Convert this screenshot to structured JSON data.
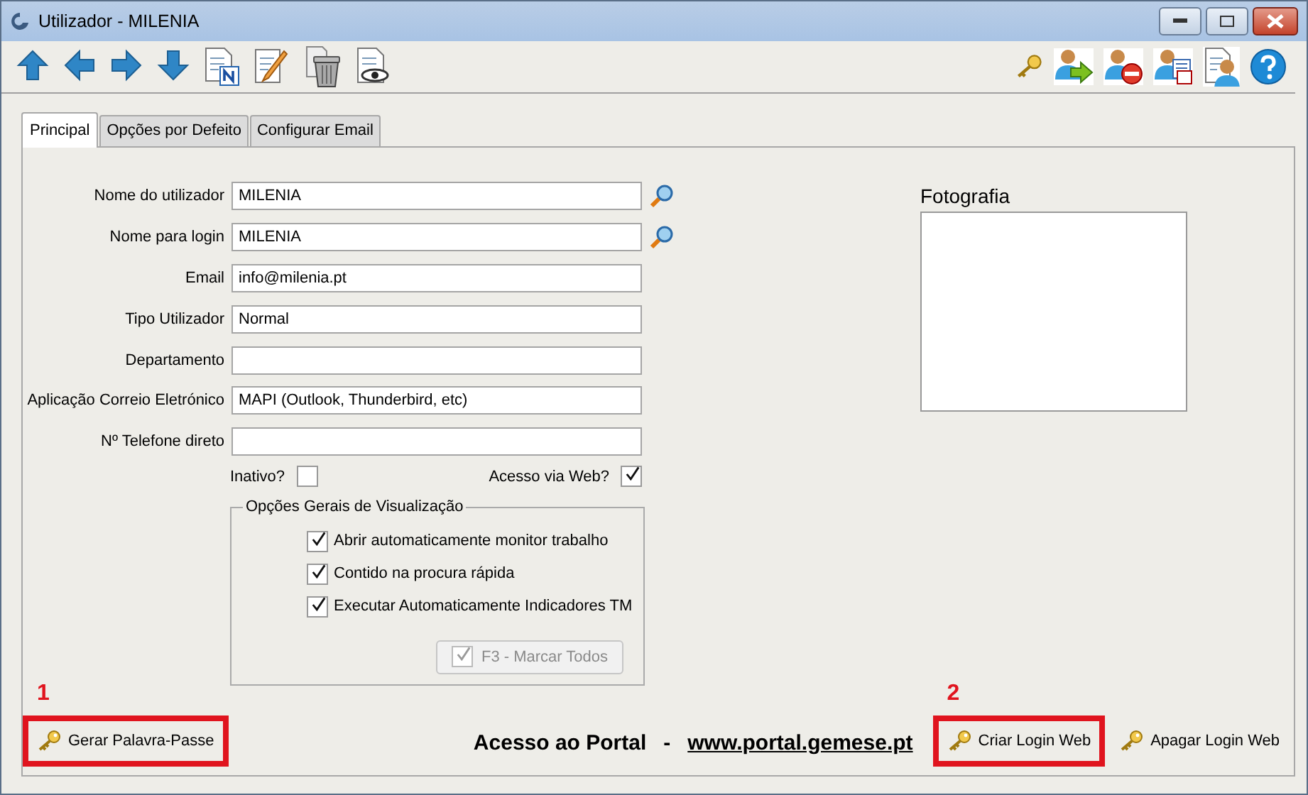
{
  "window": {
    "title": "Utilizador - MILENIA"
  },
  "toolbar": {
    "left": [
      {
        "kind": "up"
      },
      {
        "kind": "left"
      },
      {
        "kind": "right"
      },
      {
        "kind": "down"
      },
      {
        "kind": "new"
      },
      {
        "kind": "edit"
      },
      {
        "kind": "delete"
      },
      {
        "kind": "view"
      }
    ],
    "right": [
      {
        "kind": "key"
      },
      {
        "kind": "user-arrow"
      },
      {
        "kind": "user-remove"
      },
      {
        "kind": "user-calendar"
      },
      {
        "kind": "user-doc"
      },
      {
        "kind": "help"
      }
    ]
  },
  "tabs": [
    {
      "label": "Principal",
      "selected": true
    },
    {
      "label": "Opções por Defeito",
      "selected": false
    },
    {
      "label": "Configurar Email",
      "selected": false
    }
  ],
  "fields": [
    {
      "label": "Nome do utilizador",
      "value": "MILENIA",
      "search": true
    },
    {
      "label": "Nome para login",
      "value": "MILENIA",
      "search": true
    },
    {
      "label": "Email",
      "value": "info@milenia.pt",
      "search": false
    },
    {
      "label": "Tipo Utilizador",
      "value": "Normal",
      "search": false
    },
    {
      "label": "Departamento",
      "search": false
    },
    {
      "label": "Aplicação Correio Eletrónico",
      "value": "MAPI (Outlook, Thunderbird, etc)",
      "search": false
    },
    {
      "label": "Nº Telefone direto",
      "search": false
    }
  ],
  "flags": [
    {
      "label": "Inativo?",
      "checked": false
    },
    {
      "label": "Acesso via Web?",
      "checked": true
    }
  ],
  "view_options": {
    "title": "Opções Gerais de Visualização",
    "items": [
      {
        "label": "Abrir automaticamente monitor trabalho",
        "checked": true
      },
      {
        "label": "Contido na procura rápida",
        "checked": true
      },
      {
        "label": "Executar Automaticamente Indicadores TM",
        "checked": true
      }
    ],
    "button": {
      "label": "F3 - Marcar Todos",
      "disabled": true
    }
  },
  "photo": {
    "title": "Fotografia"
  },
  "footer": {
    "portal_label": "Acesso ao Portal",
    "separator": "-",
    "portal_link": "www.portal.gemese.pt",
    "buttons": [
      {
        "label": "Gerar Palavra-Passe",
        "callout": "1"
      },
      {
        "label": "Criar Login Web",
        "callout": "2"
      },
      {
        "label": "Apagar Login Web"
      }
    ]
  }
}
